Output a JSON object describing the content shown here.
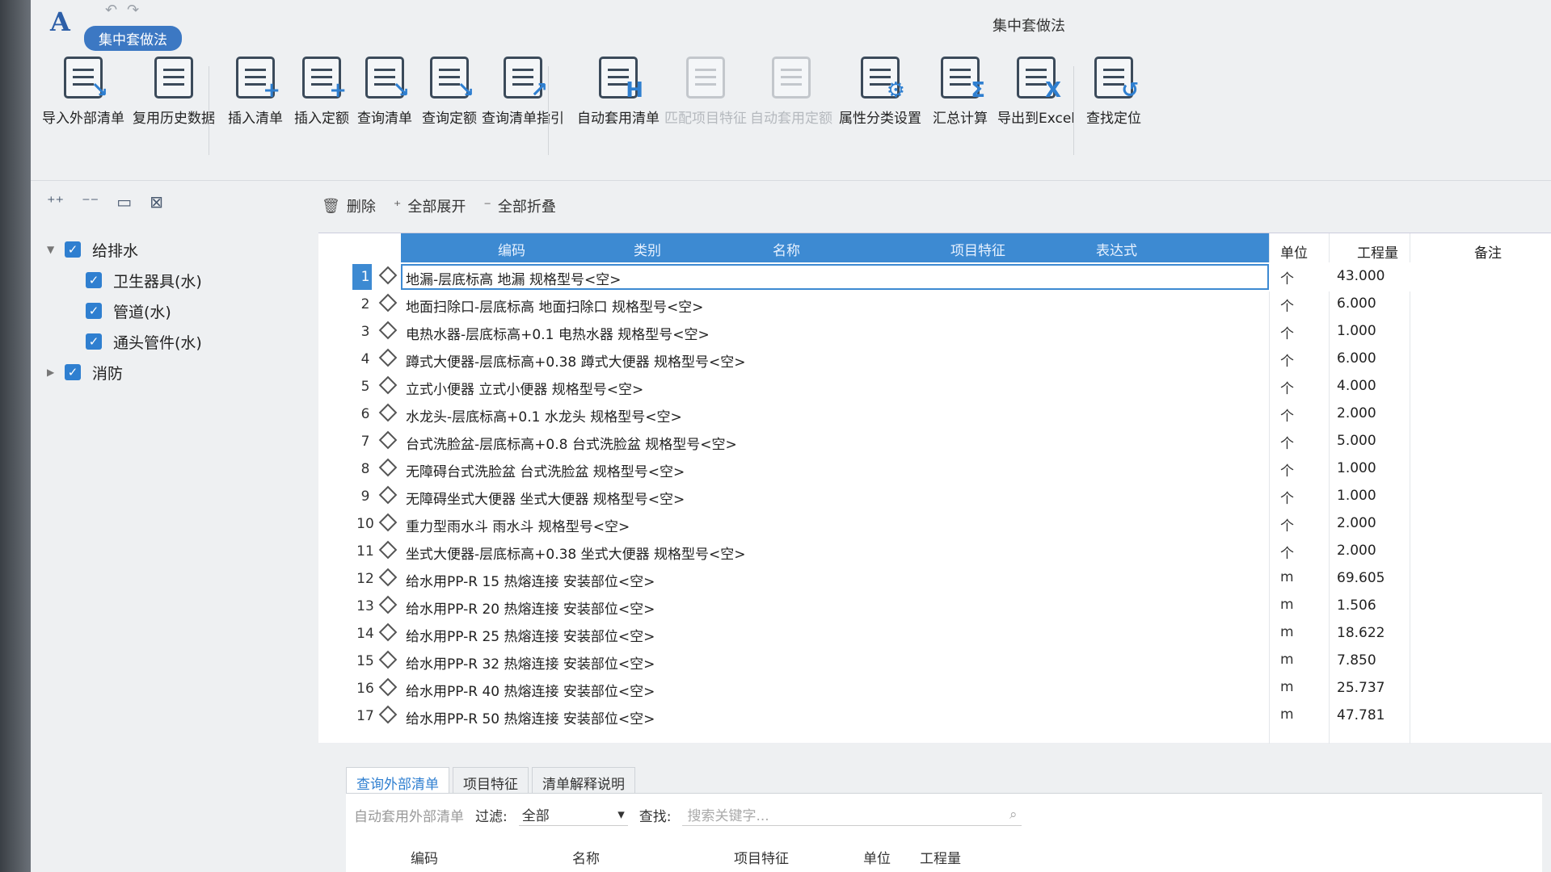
{
  "window_title": "集中套做法",
  "mode_badge": "集中套做法",
  "ribbon": [
    {
      "label": "导入外部清单",
      "icon": "import-list-icon",
      "disabled": false
    },
    {
      "label": "复用历史数据",
      "icon": "reuse-history-icon",
      "disabled": false
    },
    {
      "label": "插入清单",
      "icon": "insert-list-icon",
      "disabled": false
    },
    {
      "label": "插入定额",
      "icon": "insert-quota-icon",
      "disabled": false
    },
    {
      "label": "查询清单",
      "icon": "query-list-icon",
      "disabled": false
    },
    {
      "label": "查询定额",
      "icon": "query-quota-icon",
      "disabled": false
    },
    {
      "label": "查询清单指引",
      "icon": "query-guide-icon",
      "disabled": false
    },
    {
      "label": "自动套用清单",
      "icon": "auto-apply-list-icon",
      "disabled": false
    },
    {
      "label": "匹配项目特征",
      "icon": "match-feature-icon",
      "disabled": true
    },
    {
      "label": "自动套用定额",
      "icon": "auto-apply-quota-icon",
      "disabled": true
    },
    {
      "label": "属性分类设置",
      "icon": "attribute-settings-icon",
      "disabled": false
    },
    {
      "label": "汇总计算",
      "icon": "sum-icon",
      "disabled": false
    },
    {
      "label": "导出到Excel",
      "icon": "excel-export-icon",
      "disabled": false
    },
    {
      "label": "查找定位",
      "icon": "locate-icon",
      "disabled": false
    }
  ],
  "tree": [
    {
      "label": "给排水",
      "level": 0,
      "expanded": true
    },
    {
      "label": "卫生器具(水)",
      "level": 1
    },
    {
      "label": "管道(水)",
      "level": 1
    },
    {
      "label": "通头管件(水)",
      "level": 1
    },
    {
      "label": "消防",
      "level": 0,
      "expanded": false
    }
  ],
  "grid_toolbar": {
    "delete": "删除",
    "expand_all": "全部展开",
    "collapse_all": "全部折叠"
  },
  "grid_headers": {
    "code": "编码",
    "category": "类别",
    "name": "名称",
    "feature": "项目特征",
    "expression": "表达式",
    "unit": "单位",
    "quantity": "工程量",
    "remark": "备注"
  },
  "rows": [
    {
      "n": "1",
      "name": "地漏-层底标高 地漏 规格型号<空>",
      "unit": "个",
      "qty": "43.000"
    },
    {
      "n": "2",
      "name": "地面扫除口-层底标高 地面扫除口 规格型号<空>",
      "unit": "个",
      "qty": "6.000"
    },
    {
      "n": "3",
      "name": "电热水器-层底标高+0.1 电热水器 规格型号<空>",
      "unit": "个",
      "qty": "1.000"
    },
    {
      "n": "4",
      "name": "蹲式大便器-层底标高+0.38 蹲式大便器 规格型号<空>",
      "unit": "个",
      "qty": "6.000"
    },
    {
      "n": "5",
      "name": "立式小便器 立式小便器 规格型号<空>",
      "unit": "个",
      "qty": "4.000"
    },
    {
      "n": "6",
      "name": "水龙头-层底标高+0.1 水龙头 规格型号<空>",
      "unit": "个",
      "qty": "2.000"
    },
    {
      "n": "7",
      "name": "台式洗脸盆-层底标高+0.8 台式洗脸盆 规格型号<空>",
      "unit": "个",
      "qty": "5.000"
    },
    {
      "n": "8",
      "name": "无障碍台式洗脸盆 台式洗脸盆 规格型号<空>",
      "unit": "个",
      "qty": "1.000"
    },
    {
      "n": "9",
      "name": "无障碍坐式大便器 坐式大便器 规格型号<空>",
      "unit": "个",
      "qty": "1.000"
    },
    {
      "n": "10",
      "name": "重力型雨水斗 雨水斗 规格型号<空>",
      "unit": "个",
      "qty": "2.000"
    },
    {
      "n": "11",
      "name": "坐式大便器-层底标高+0.38 坐式大便器 规格型号<空>",
      "unit": "个",
      "qty": "2.000"
    },
    {
      "n": "12",
      "name": "给水用PP-R 15 热熔连接 安装部位<空>",
      "unit": "m",
      "qty": "69.605"
    },
    {
      "n": "13",
      "name": "给水用PP-R 20 热熔连接 安装部位<空>",
      "unit": "m",
      "qty": "1.506"
    },
    {
      "n": "14",
      "name": "给水用PP-R 25 热熔连接 安装部位<空>",
      "unit": "m",
      "qty": "18.622"
    },
    {
      "n": "15",
      "name": "给水用PP-R 32 热熔连接 安装部位<空>",
      "unit": "m",
      "qty": "7.850"
    },
    {
      "n": "16",
      "name": "给水用PP-R 40 热熔连接 安装部位<空>",
      "unit": "m",
      "qty": "25.737"
    },
    {
      "n": "17",
      "name": "给水用PP-R 50 热熔连接 安装部位<空>",
      "unit": "m",
      "qty": "47.781"
    }
  ],
  "bottom_tabs": [
    "查询外部清单",
    "项目特征",
    "清单解释说明"
  ],
  "bottom": {
    "auto_apply": "自动套用外部清单",
    "filter_label": "过滤:",
    "filter_value": "全部",
    "search_label": "查找:",
    "search_placeholder": "搜索关键字...",
    "headers": {
      "code": "编码",
      "name": "名称",
      "feature": "项目特征",
      "unit": "单位",
      "quantity": "工程量"
    }
  },
  "colors": {
    "accent": "#3d8ad2",
    "selected_header": "#3d8ad2"
  }
}
